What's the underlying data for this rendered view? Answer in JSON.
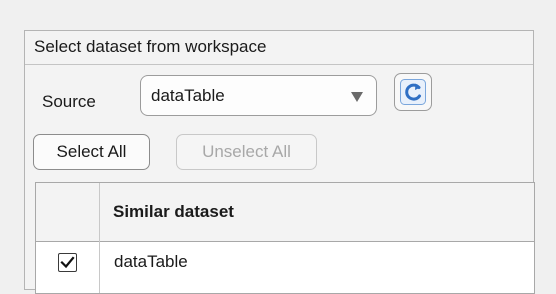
{
  "panel": {
    "title": "Select dataset from workspace"
  },
  "source": {
    "label": "Source",
    "selected": "dataTable"
  },
  "buttons": {
    "select_all": "Select All",
    "unselect_all": "Unselect All"
  },
  "table": {
    "columns": [
      "",
      "Similar dataset"
    ],
    "rows": [
      {
        "checked": true,
        "name": "dataTable"
      }
    ]
  },
  "icons": {
    "refresh": "refresh-icon",
    "dropdown": "chevron-down-icon",
    "check": "checkmark-icon"
  },
  "colors": {
    "refresh_icon": "#4a8ad4",
    "disabled_text": "#a8a8a8"
  }
}
